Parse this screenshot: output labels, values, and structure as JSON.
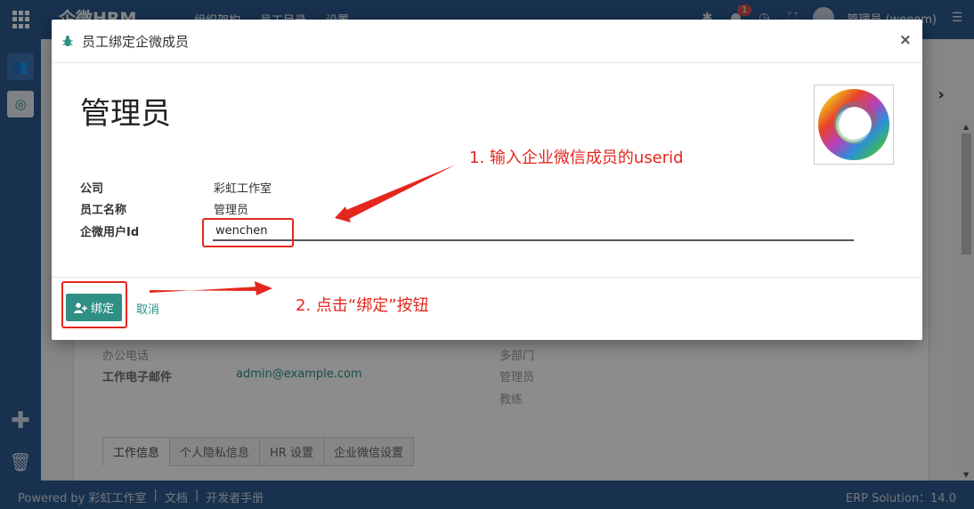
{
  "app": {
    "brand": "企微HRM",
    "nav": [
      "组织架构",
      "员工目录",
      "设置"
    ],
    "notification_count": "1",
    "user": "管理员 (weeem)"
  },
  "background_form": {
    "office_phone_label": "办公电话",
    "work_email_label": "工作电子邮件",
    "work_email_value": "admin@example.com",
    "dept_values": [
      "多部门",
      "管理员",
      "教练"
    ],
    "tabs": [
      "工作信息",
      "个人隐私信息",
      "HR 设置",
      "企业微信设置"
    ]
  },
  "footer": {
    "powered_by": "Powered by 彩虹工作室",
    "links": [
      "文档",
      "开发者手册"
    ],
    "version": "ERP Solution：14.0"
  },
  "modal": {
    "title": "员工绑定企微成员",
    "employee_name": "管理员",
    "fields": {
      "company_label": "公司",
      "company_value": "彩虹工作室",
      "employee_label": "员工名称",
      "employee_value": "管理员",
      "userid_label": "企微用户Id",
      "userid_value": "wenchen"
    },
    "bind_label": "绑定",
    "cancel_label": "取消"
  },
  "annotations": {
    "step1": "1. 输入企业微信成员的userid",
    "step2": "2. 点击“绑定”按钮"
  },
  "colors": {
    "nav_bg": "#2c5a8e",
    "primary_button": "#2e8f84",
    "annotation_red": "#e4261c"
  }
}
